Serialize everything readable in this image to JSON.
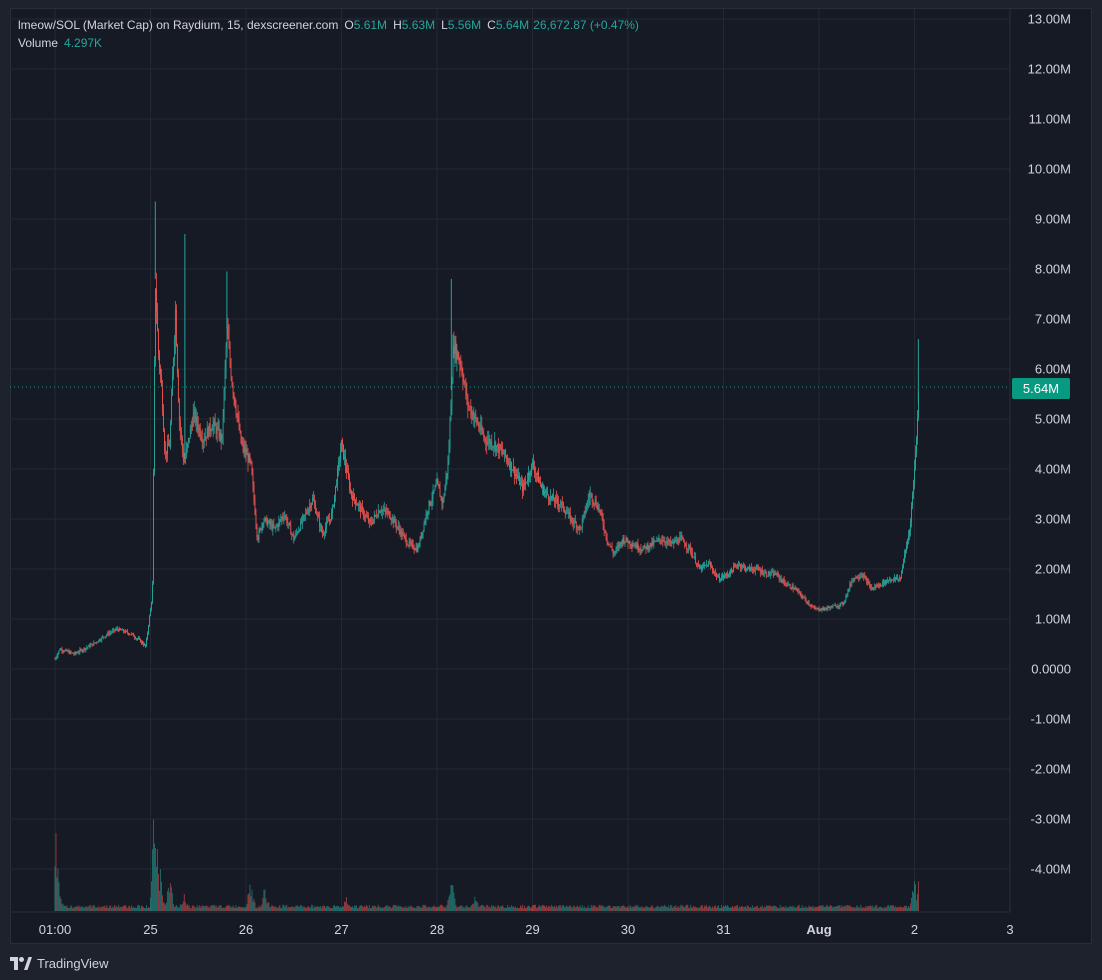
{
  "legend": {
    "symbol": "lmeow/SOL (Market Cap) on Raydium, 15, dexscreener.com",
    "o_label": "O",
    "o_value": "5.61M",
    "h_label": "H",
    "h_value": "5.63M",
    "l_label": "L",
    "l_value": "5.56M",
    "c_label": "C",
    "c_value": "5.64M",
    "change": "26,672.87 (+0.47%)",
    "volume_label": "Volume",
    "volume_value": "4.297K"
  },
  "price_badge": "5.64M",
  "footer": {
    "brand": "TradingView",
    "logo_icon": "tradingview-logo-icon"
  },
  "colors": {
    "up": "#26a69a",
    "down": "#ef5350",
    "badge": "#089981",
    "background": "#161a25",
    "grid": "#242833",
    "text": "#d1d4dc"
  },
  "chart_data": {
    "type": "candlestick",
    "title": "lmeow/SOL (Market Cap) on Raydium, 15, dexscreener.com",
    "y_ticks": [
      "13.00M",
      "12.00M",
      "11.00M",
      "10.00M",
      "9.00M",
      "8.00M",
      "7.00M",
      "6.00M",
      "5.00M",
      "4.00M",
      "3.00M",
      "2.00M",
      "1.00M",
      "0.0000",
      "-1.00M",
      "-2.00M",
      "-3.00M",
      "-4.00M"
    ],
    "y_tick_values": [
      13,
      12,
      11,
      10,
      9,
      8,
      7,
      6,
      5,
      4,
      3,
      2,
      1,
      0,
      -1,
      -2,
      -3,
      -4
    ],
    "x_ticks": [
      "01:00",
      "25",
      "26",
      "27",
      "28",
      "29",
      "30",
      "31",
      "Aug",
      "2",
      "3"
    ],
    "x_tick_days": [
      0,
      1,
      2,
      3,
      4,
      5,
      6,
      7,
      8,
      9,
      10
    ],
    "ylim": [
      -4.85,
      13.0
    ],
    "grid": true,
    "last_value": 5.64,
    "unit": "M",
    "series_market_cap": [
      [
        0.0,
        0.2
      ],
      [
        0.05,
        0.4
      ],
      [
        0.2,
        0.3
      ],
      [
        0.4,
        0.5
      ],
      [
        0.55,
        0.7
      ],
      [
        0.65,
        0.8
      ],
      [
        0.8,
        0.7
      ],
      [
        0.9,
        0.55
      ],
      [
        0.95,
        0.45
      ],
      [
        1.02,
        1.5
      ],
      [
        1.05,
        7.8
      ],
      [
        1.08,
        6.4
      ],
      [
        1.12,
        5.5
      ],
      [
        1.15,
        4.3
      ],
      [
        1.2,
        4.5
      ],
      [
        1.26,
        7.2
      ],
      [
        1.3,
        5.0
      ],
      [
        1.35,
        4.1
      ],
      [
        1.45,
        5.1
      ],
      [
        1.55,
        4.6
      ],
      [
        1.65,
        4.9
      ],
      [
        1.75,
        4.6
      ],
      [
        1.8,
        6.8
      ],
      [
        1.85,
        5.8
      ],
      [
        1.95,
        4.5
      ],
      [
        2.05,
        4.1
      ],
      [
        2.12,
        2.6
      ],
      [
        2.18,
        3.0
      ],
      [
        2.3,
        2.8
      ],
      [
        2.4,
        3.1
      ],
      [
        2.5,
        2.6
      ],
      [
        2.6,
        3.0
      ],
      [
        2.7,
        3.4
      ],
      [
        2.8,
        2.7
      ],
      [
        2.9,
        3.1
      ],
      [
        3.0,
        4.5
      ],
      [
        3.1,
        3.5
      ],
      [
        3.2,
        3.2
      ],
      [
        3.3,
        2.9
      ],
      [
        3.4,
        3.2
      ],
      [
        3.5,
        3.1
      ],
      [
        3.6,
        2.8
      ],
      [
        3.7,
        2.5
      ],
      [
        3.8,
        2.4
      ],
      [
        3.9,
        3.2
      ],
      [
        4.0,
        3.7
      ],
      [
        4.06,
        3.3
      ],
      [
        4.12,
        4.2
      ],
      [
        4.17,
        6.5
      ],
      [
        4.25,
        6.1
      ],
      [
        4.32,
        5.3
      ],
      [
        4.4,
        5.0
      ],
      [
        4.5,
        4.6
      ],
      [
        4.6,
        4.5
      ],
      [
        4.7,
        4.3
      ],
      [
        4.8,
        4.0
      ],
      [
        4.9,
        3.6
      ],
      [
        5.0,
        4.1
      ],
      [
        5.1,
        3.6
      ],
      [
        5.2,
        3.4
      ],
      [
        5.3,
        3.3
      ],
      [
        5.4,
        3.0
      ],
      [
        5.5,
        2.8
      ],
      [
        5.6,
        3.5
      ],
      [
        5.7,
        3.2
      ],
      [
        5.78,
        2.6
      ],
      [
        5.85,
        2.3
      ],
      [
        5.95,
        2.6
      ],
      [
        6.05,
        2.5
      ],
      [
        6.15,
        2.4
      ],
      [
        6.25,
        2.5
      ],
      [
        6.35,
        2.6
      ],
      [
        6.45,
        2.5
      ],
      [
        6.55,
        2.6
      ],
      [
        6.65,
        2.4
      ],
      [
        6.75,
        2.0
      ],
      [
        6.85,
        2.1
      ],
      [
        6.95,
        1.8
      ],
      [
        7.05,
        1.9
      ],
      [
        7.15,
        2.1
      ],
      [
        7.25,
        2.0
      ],
      [
        7.35,
        2.0
      ],
      [
        7.45,
        1.9
      ],
      [
        7.55,
        1.9
      ],
      [
        7.65,
        1.7
      ],
      [
        7.75,
        1.6
      ],
      [
        7.85,
        1.4
      ],
      [
        7.95,
        1.2
      ],
      [
        8.05,
        1.2
      ],
      [
        8.15,
        1.25
      ],
      [
        8.25,
        1.3
      ],
      [
        8.35,
        1.8
      ],
      [
        8.45,
        1.9
      ],
      [
        8.55,
        1.6
      ],
      [
        8.65,
        1.7
      ],
      [
        8.75,
        1.8
      ],
      [
        8.85,
        1.8
      ],
      [
        8.95,
        2.8
      ],
      [
        9.0,
        4.0
      ],
      [
        9.05,
        5.64
      ]
    ],
    "volume_peaks": [
      [
        0.0,
        0.55
      ],
      [
        0.05,
        0.1
      ],
      [
        1.05,
        0.75
      ],
      [
        1.1,
        0.25
      ],
      [
        1.2,
        0.2
      ],
      [
        1.35,
        0.12
      ],
      [
        2.05,
        0.18
      ],
      [
        2.2,
        0.15
      ],
      [
        3.05,
        0.1
      ],
      [
        4.15,
        0.2
      ],
      [
        4.4,
        0.1
      ],
      [
        9.0,
        0.18
      ],
      [
        9.05,
        0.22
      ]
    ],
    "volume_max": 4.3,
    "volume_unit": "K"
  }
}
